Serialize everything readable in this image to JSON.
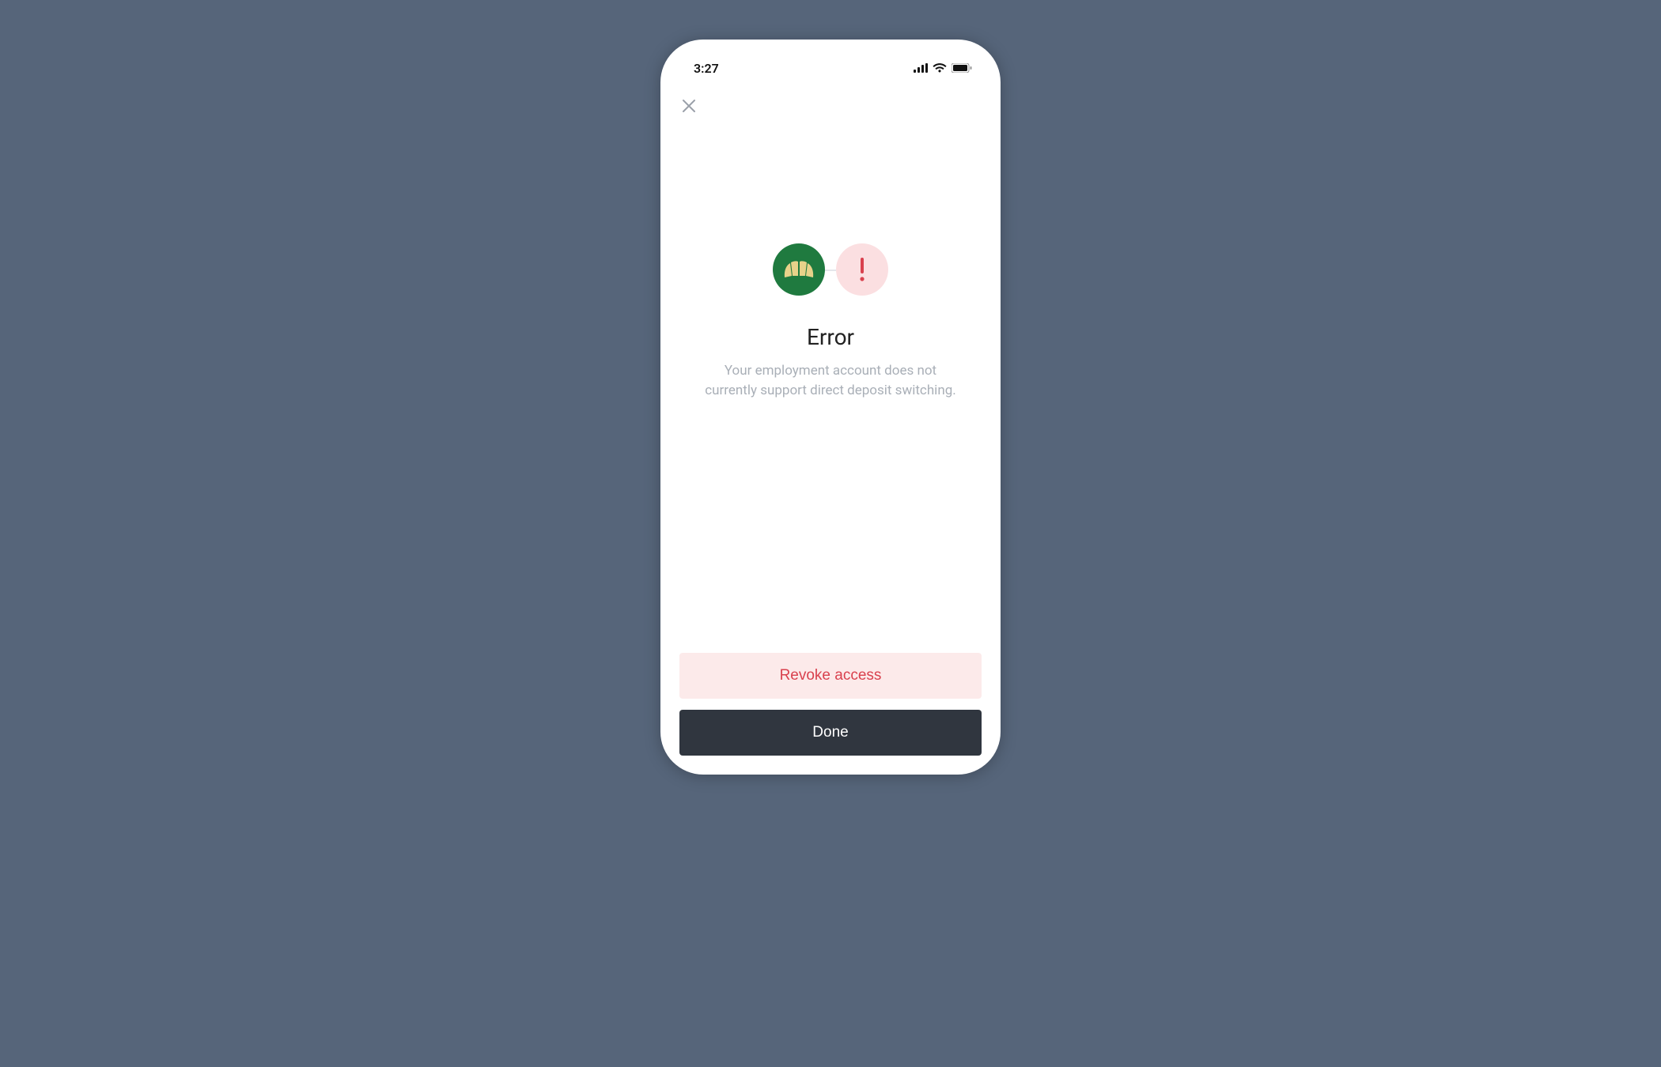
{
  "status_bar": {
    "time": "3:27"
  },
  "header": {
    "close_icon_name": "close-icon"
  },
  "error": {
    "heading": "Error",
    "body": "Your employment account does not currently support direct deposit switching."
  },
  "icons": {
    "brand_circle_color": "#1f7a3f",
    "error_circle_color": "#fbdfe1",
    "error_glyph_color": "#d9414e"
  },
  "buttons": {
    "revoke_label": "Revoke access",
    "done_label": "Done"
  }
}
